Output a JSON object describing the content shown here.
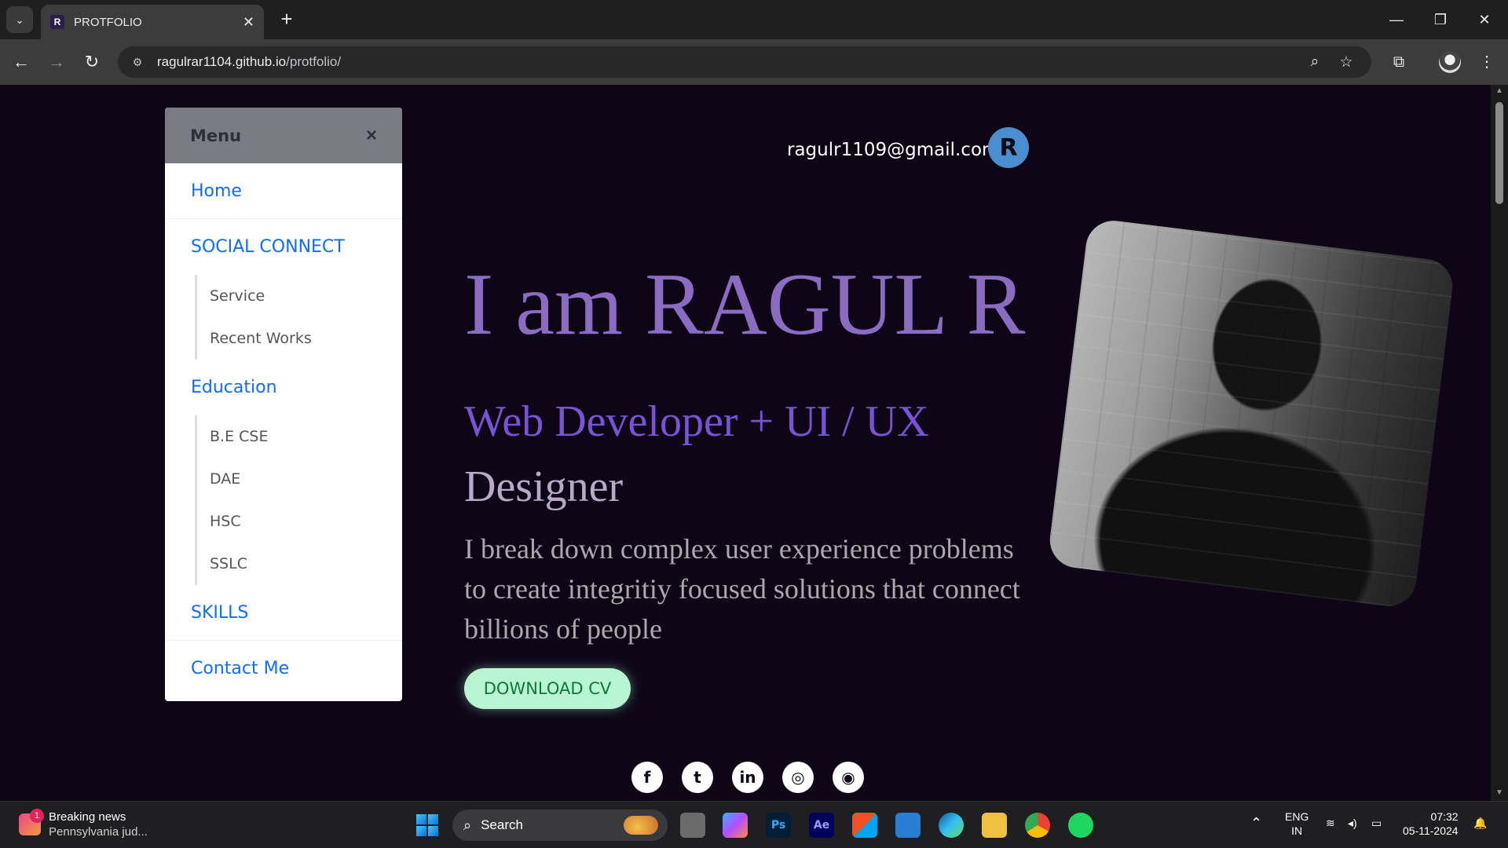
{
  "browser": {
    "tab_title": "PROTFOLIO",
    "favicon_letter": "R",
    "url_host": "ragulrar1104.github.io",
    "url_path": "/protfolio/"
  },
  "page": {
    "menu": {
      "title": "Menu",
      "close_glyph": "×",
      "items": [
        {
          "label": "Home"
        },
        {
          "label": "SOCIAL CONNECT",
          "children": [
            "Service",
            "Recent Works"
          ]
        },
        {
          "label": "Education",
          "children": [
            "B.E CSE",
            "DAE",
            "HSC",
            "SSLC"
          ]
        },
        {
          "label": "SKILLS"
        },
        {
          "label": "Contact Me"
        }
      ]
    },
    "header": {
      "email": "ragulr1109@gmail.com",
      "avatar_letter": "R"
    },
    "hero": {
      "title": "I am RAGUL R",
      "role_highlight": "Web Developer + UI / UX",
      "role_rest": "Designer",
      "description": "I break down complex user experience problems to create integritiy focused solutions that connect billions of people",
      "download_label": "DOWNLOAD CV"
    },
    "social": [
      "facebook-icon",
      "twitter-icon",
      "linkedin-icon",
      "instagram-icon",
      "github-icon"
    ],
    "colors": {
      "background": "#0e0617",
      "title_purple": "#8c6bc2",
      "role_purple": "#7a52d6",
      "button_green": "#b9f5d2",
      "link_blue": "#0d6efd"
    }
  },
  "taskbar": {
    "news_title": "Breaking news",
    "news_subtitle": "Pennsylvania jud...",
    "news_badge": "1",
    "search_label": "Search",
    "lang_top": "ENG",
    "lang_bottom": "IN",
    "time": "07:32",
    "date": "05-11-2024"
  }
}
